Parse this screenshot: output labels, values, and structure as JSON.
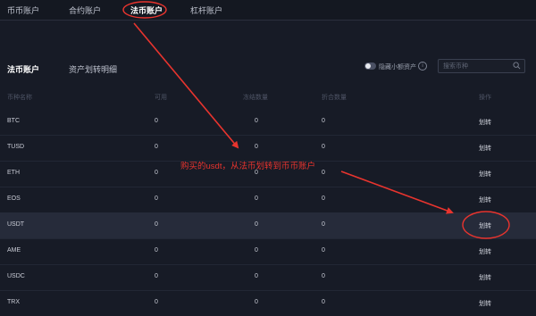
{
  "top_tabs": [
    {
      "label": "币币账户"
    },
    {
      "label": "合约账户"
    },
    {
      "label": "法币账户"
    },
    {
      "label": "杠杆账户"
    }
  ],
  "sub_tabs": [
    {
      "label": "法币账户"
    },
    {
      "label": "资产划转明细"
    }
  ],
  "toggle": {
    "label": "隐藏小额资产"
  },
  "search": {
    "placeholder": "搜索币种"
  },
  "columns": [
    "币种名称",
    "可用",
    "冻结数量",
    "折合数量",
    "操作"
  ],
  "rows": [
    {
      "coin": "BTC",
      "available": "0",
      "frozen": "0",
      "equiv": "0",
      "action": "划转"
    },
    {
      "coin": "TUSD",
      "available": "0",
      "frozen": "0",
      "equiv": "0",
      "action": "划转"
    },
    {
      "coin": "ETH",
      "available": "0",
      "frozen": "0",
      "equiv": "0",
      "action": "划转"
    },
    {
      "coin": "EOS",
      "available": "0",
      "frozen": "0",
      "equiv": "0",
      "action": "划转"
    },
    {
      "coin": "USDT",
      "available": "0",
      "frozen": "0",
      "equiv": "0",
      "action": "划转"
    },
    {
      "coin": "AME",
      "available": "0",
      "frozen": "0",
      "equiv": "0",
      "action": "划转"
    },
    {
      "coin": "USDC",
      "available": "0",
      "frozen": "0",
      "equiv": "0",
      "action": "划转"
    },
    {
      "coin": "TRX",
      "available": "0",
      "frozen": "0",
      "equiv": "0",
      "action": "划转"
    }
  ],
  "annotation": {
    "text": "购买的usdt，从法币划转到币币账户",
    "color": "#e8342e"
  },
  "colors": {
    "background": "#171b26",
    "highlight_row": "#262b3a",
    "annotation": "#e8342e"
  }
}
